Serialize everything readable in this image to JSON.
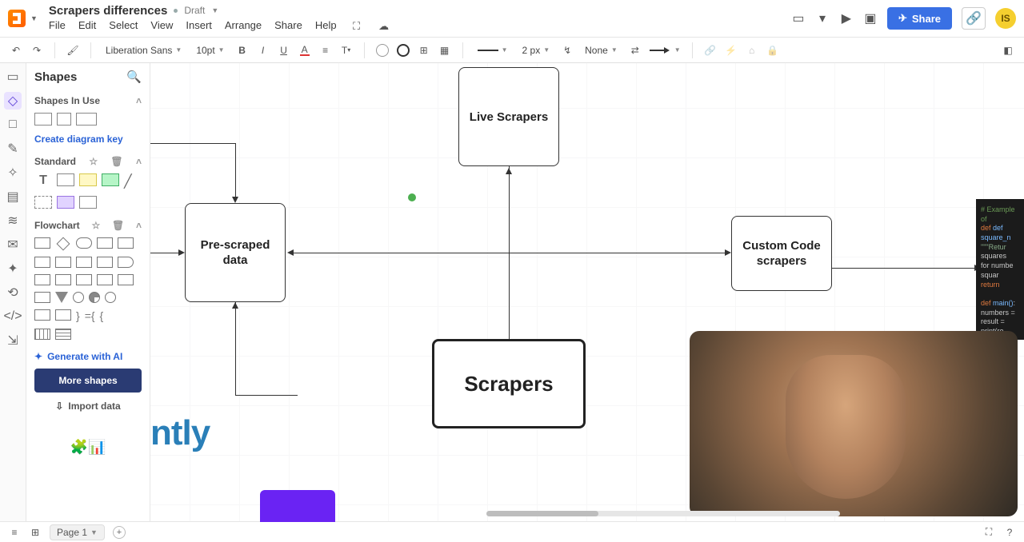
{
  "header": {
    "doc_title": "Scrapers differences",
    "status": "Draft",
    "menu": [
      "File",
      "Edit",
      "Select",
      "View",
      "Insert",
      "Arrange",
      "Share",
      "Help"
    ],
    "share_label": "Share",
    "avatar_initials": "IS"
  },
  "toolbar": {
    "font_family": "Liberation Sans",
    "font_size": "10pt",
    "stroke_width": "2 px",
    "line_end_style": "None",
    "bold": "B",
    "italic": "I",
    "underline": "U"
  },
  "shapes_panel": {
    "title": "Shapes",
    "sect_in_use": "Shapes In Use",
    "create_key": "Create diagram key",
    "sect_standard": "Standard",
    "sect_flowchart": "Flowchart",
    "generate_ai": "Generate with AI",
    "more_shapes": "More shapes",
    "import_data": "Import data"
  },
  "canvas": {
    "nodes": {
      "live_scrapers": "Live Scrapers",
      "pre_scraped": "Pre-scraped data",
      "custom_code": "Custom Code scrapers",
      "scrapers": "Scrapers"
    },
    "text_fragment": "ntly",
    "code_lines": [
      "# Example of",
      "def square_n",
      "    \"\"\"Retur",
      "    squares",
      "    for numbe",
      "        squar",
      "    return sq",
      "",
      "def main():",
      "    numbers =",
      "    result =",
      "    print(re"
    ]
  },
  "bottombar": {
    "page_label": "Page 1"
  }
}
